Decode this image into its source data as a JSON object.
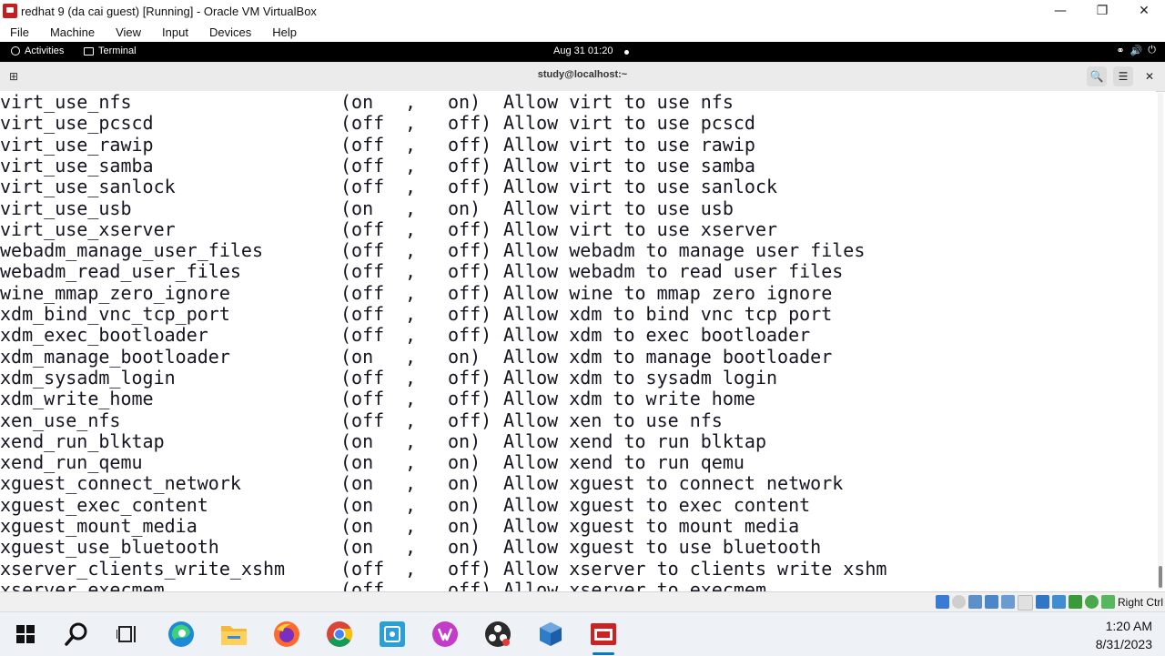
{
  "window": {
    "title": "redhat 9 (da cai guest) [Running] - Oracle VM VirtualBox",
    "controls": [
      "—",
      "❐",
      "✕"
    ]
  },
  "menu": [
    "File",
    "Machine",
    "View",
    "Input",
    "Devices",
    "Help"
  ],
  "gnome": {
    "activities": "Activities",
    "terminal_task": "Terminal",
    "clock": "Aug 31  01:20"
  },
  "terminal": {
    "title": "study@localhost:~",
    "lines": [
      {
        "name": "virt_use_nfs",
        "cur": "(on",
        "comma": ",",
        "def": "on)",
        "desc": "Allow virt to use nfs"
      },
      {
        "name": "virt_use_pcscd",
        "cur": "(off",
        "comma": ",",
        "def": "off)",
        "desc": "Allow virt to use pcscd"
      },
      {
        "name": "virt_use_rawip",
        "cur": "(off",
        "comma": ",",
        "def": "off)",
        "desc": "Allow virt to use rawip"
      },
      {
        "name": "virt_use_samba",
        "cur": "(off",
        "comma": ",",
        "def": "off)",
        "desc": "Allow virt to use samba"
      },
      {
        "name": "virt_use_sanlock",
        "cur": "(off",
        "comma": ",",
        "def": "off)",
        "desc": "Allow virt to use sanlock"
      },
      {
        "name": "virt_use_usb",
        "cur": "(on",
        "comma": ",",
        "def": "on)",
        "desc": "Allow virt to use usb"
      },
      {
        "name": "virt_use_xserver",
        "cur": "(off",
        "comma": ",",
        "def": "off)",
        "desc": "Allow virt to use xserver"
      },
      {
        "name": "webadm_manage_user_files",
        "cur": "(off",
        "comma": ",",
        "def": "off)",
        "desc": "Allow webadm to manage user files"
      },
      {
        "name": "webadm_read_user_files",
        "cur": "(off",
        "comma": ",",
        "def": "off)",
        "desc": "Allow webadm to read user files"
      },
      {
        "name": "wine_mmap_zero_ignore",
        "cur": "(off",
        "comma": ",",
        "def": "off)",
        "desc": "Allow wine to mmap zero ignore"
      },
      {
        "name": "xdm_bind_vnc_tcp_port",
        "cur": "(off",
        "comma": ",",
        "def": "off)",
        "desc": "Allow xdm to bind vnc tcp port"
      },
      {
        "name": "xdm_exec_bootloader",
        "cur": "(off",
        "comma": ",",
        "def": "off)",
        "desc": "Allow xdm to exec bootloader"
      },
      {
        "name": "xdm_manage_bootloader",
        "cur": "(on",
        "comma": ",",
        "def": "on)",
        "desc": "Allow xdm to manage bootloader"
      },
      {
        "name": "xdm_sysadm_login",
        "cur": "(off",
        "comma": ",",
        "def": "off)",
        "desc": "Allow xdm to sysadm login"
      },
      {
        "name": "xdm_write_home",
        "cur": "(off",
        "comma": ",",
        "def": "off)",
        "desc": "Allow xdm to write home"
      },
      {
        "name": "xen_use_nfs",
        "cur": "(off",
        "comma": ",",
        "def": "off)",
        "desc": "Allow xen to use nfs"
      },
      {
        "name": "xend_run_blktap",
        "cur": "(on",
        "comma": ",",
        "def": "on)",
        "desc": "Allow xend to run blktap"
      },
      {
        "name": "xend_run_qemu",
        "cur": "(on",
        "comma": ",",
        "def": "on)",
        "desc": "Allow xend to run qemu"
      },
      {
        "name": "xguest_connect_network",
        "cur": "(on",
        "comma": ",",
        "def": "on)",
        "desc": "Allow xguest to connect network"
      },
      {
        "name": "xguest_exec_content",
        "cur": "(on",
        "comma": ",",
        "def": "on)",
        "desc": "Allow xguest to exec content"
      },
      {
        "name": "xguest_mount_media",
        "cur": "(on",
        "comma": ",",
        "def": "on)",
        "desc": "Allow xguest to mount media"
      },
      {
        "name": "xguest_use_bluetooth",
        "cur": "(on",
        "comma": ",",
        "def": "on)",
        "desc": "Allow xguest to use bluetooth"
      },
      {
        "name": "xserver_clients_write_xshm",
        "cur": "(off",
        "comma": ",",
        "def": "off)",
        "desc": "Allow xserver to clients write xshm"
      },
      {
        "name": "xserver_execmem",
        "cur": "(off",
        "comma": ",",
        "def": "off)",
        "desc": "Allow xserver to execmem"
      }
    ]
  },
  "statusbar": {
    "host_key": "Right Ctrl"
  },
  "taskbar": {
    "time": "1:20 AM",
    "date": "8/31/2023"
  },
  "colors": {
    "terminal_text": "#171421",
    "gnome_bar": "#000000",
    "taskbar": "#eef1f6",
    "accent": "#0078d4"
  }
}
